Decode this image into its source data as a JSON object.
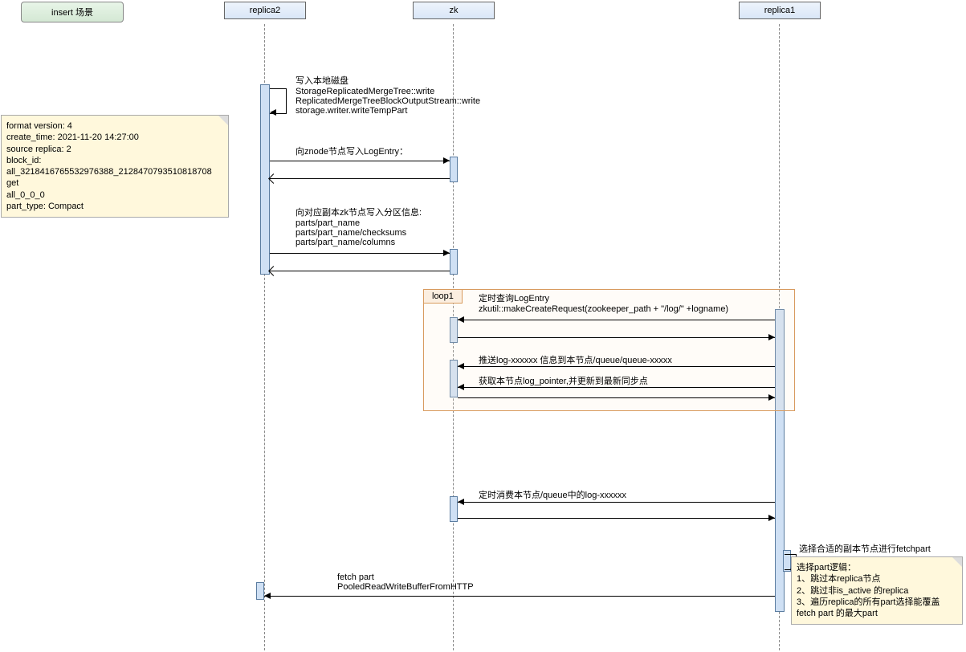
{
  "title": "insert 场景",
  "participants": {
    "replica2": "replica2",
    "zk": "zk",
    "replica1": "replica1"
  },
  "note1": {
    "l1": "format version: 4",
    "l2": "create_time: 2021-11-20 14:27:00",
    "l3": "source replica: 2",
    "l4": "block_id:",
    "l5": "all_3218416765532976388_2128470793510818708",
    "l6": "get",
    "l7": "all_0_0_0",
    "l8": "part_type: Compact"
  },
  "msg1": {
    "l1": "写入本地磁盘",
    "l2": "StorageReplicatedMergeTree::write",
    "l3": "ReplicatedMergeTreeBlockOutputStream::write",
    "l4": "storage.writer.writeTempPart"
  },
  "msg2": "向znode节点写入LogEntry：",
  "msg3": {
    "l1": "向对应副本zk节点写入分区信息:",
    "l2": "parts/part_name",
    "l3": "parts/part_name/checksums",
    "l4": "parts/part_name/columns"
  },
  "loop_label": "loop1",
  "msg4": {
    "l1": "定时查询LogEntry",
    "l2": "zkutil::makeCreateRequest(zookeeper_path + \"/log/\" +logname)"
  },
  "msg5": "推送log-xxxxxx 信息到本节点/queue/queue-xxxxx",
  "msg6": "获取本节点log_pointer,并更新到最新同步点",
  "msg7": "定时消费本节点/queue中的log-xxxxxx",
  "msg8": "选择合适的副本节点进行fetchpart",
  "msg9": {
    "l1": "fetch part",
    "l2": "PooledReadWriteBufferFromHTTP"
  },
  "note2": {
    "l1": "选择part逻辑：",
    "l2": "1、跳过本replica节点",
    "l3": "2、跳过非is_active 的replica",
    "l4": "3、遍历replica的所有part选择能覆盖",
    "l5": "fetch part 的最大part"
  }
}
